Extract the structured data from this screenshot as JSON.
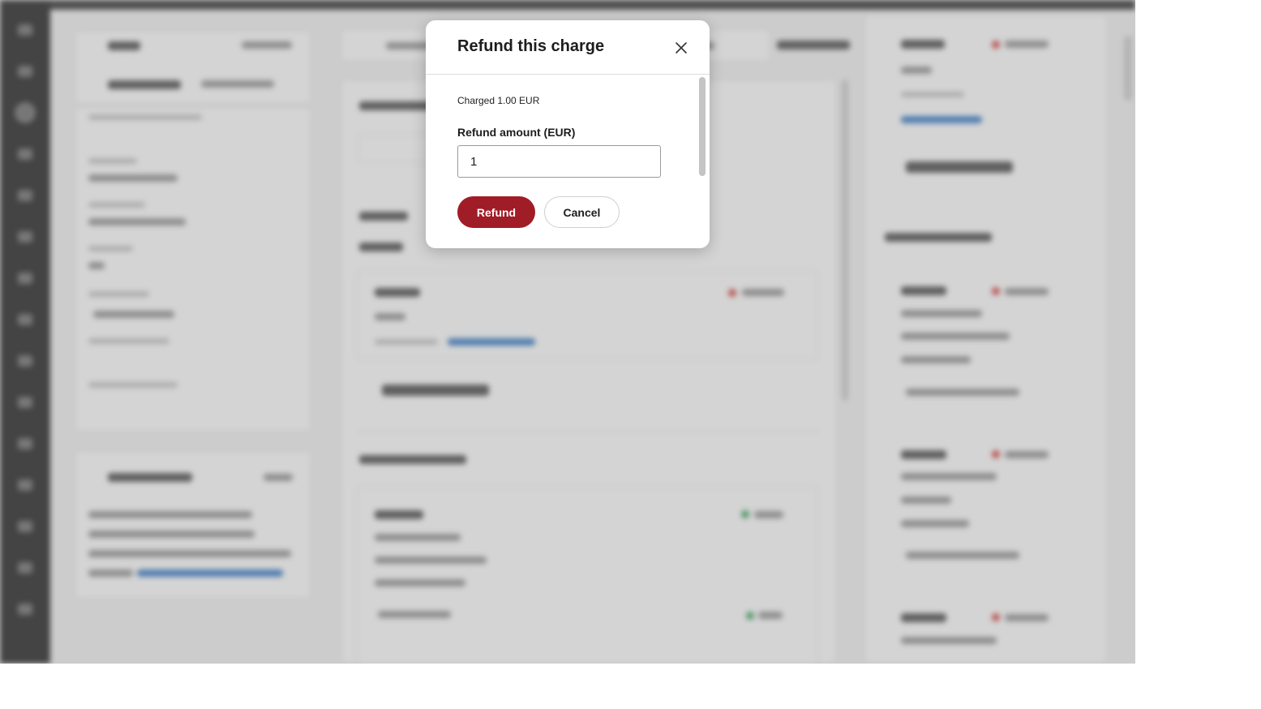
{
  "background": {
    "rail_icon_count": 15
  },
  "modal": {
    "title": "Refund this charge",
    "close_icon": "close-icon",
    "charged_text": "Charged 1.00 EUR",
    "amount_label": "Refund amount (EUR)",
    "amount_value": "1",
    "refund_label": "Refund",
    "cancel_label": "Cancel"
  },
  "colors": {
    "primary": "#a01c26",
    "overlay": "rgba(120,120,120,0.32)"
  }
}
